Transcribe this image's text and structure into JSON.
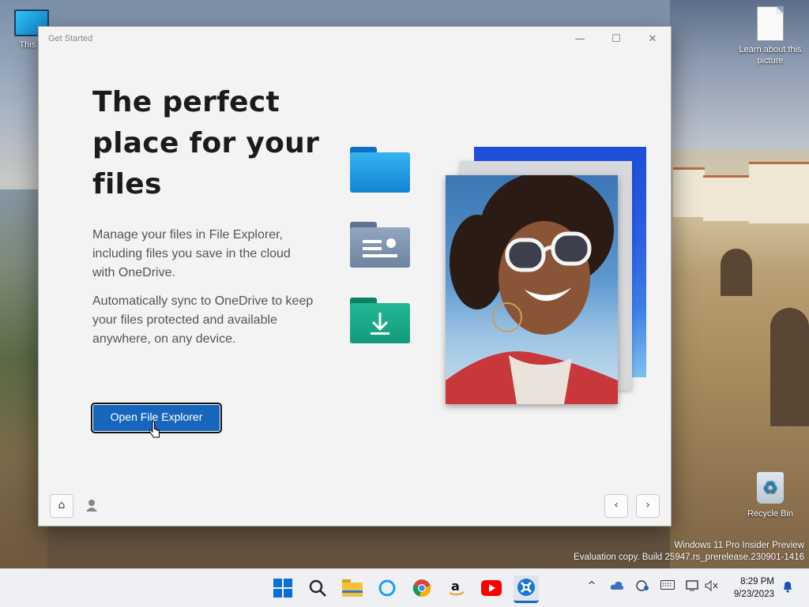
{
  "desktop": {
    "icons": [
      {
        "label": "This P"
      },
      {
        "label": "Learn about this picture"
      },
      {
        "label": "Recycle Bin"
      }
    ],
    "watermark": {
      "line1": "Windows 11 Pro Insider Preview",
      "line2": "Evaluation copy. Build 25947.rs_prerelease.230901-1416"
    }
  },
  "window": {
    "title": "Get Started",
    "controls": {
      "minimize": "—",
      "maximize": "☐",
      "close": "✕"
    },
    "heading": "The perfect place for your files",
    "paragraph1": "Manage your files in File Explorer, including files you save in the cloud with OneDrive.",
    "paragraph2": "Automatically sync to OneDrive to keep your files protected and available anywhere, on any device.",
    "primary_button": "Open File Explorer",
    "footer": {
      "home": "⌂",
      "back": "‹",
      "next": "›"
    }
  },
  "taskbar": {
    "apps": [
      "start-icon",
      "search-icon",
      "file-explorer-icon",
      "cortana-icon",
      "chrome-icon",
      "amazon-icon",
      "youtube-icon",
      "get-started-icon"
    ],
    "clock": {
      "time": "8:29 PM",
      "date": "9/23/2023"
    }
  },
  "colors": {
    "accent": "#1766bd",
    "folder_blue": "#1f9be0",
    "folder_gray": "#7c8fa8",
    "folder_green": "#17a386"
  }
}
